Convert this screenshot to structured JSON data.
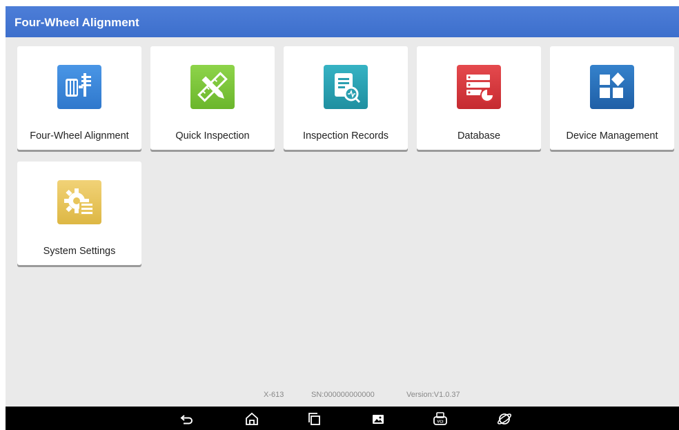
{
  "header": {
    "title": "Four-Wheel Alignment",
    "color": "#4678d4"
  },
  "tiles": [
    {
      "label": "Four-Wheel Alignment",
      "icon": "wheel-alignment-icon",
      "color": "#3a86d8"
    },
    {
      "label": "Quick Inspection",
      "icon": "ruler-pencil-icon",
      "color": "#7cc53c"
    },
    {
      "label": "Inspection Records",
      "icon": "document-search-icon",
      "color": "#2a9fb0"
    },
    {
      "label": "Database",
      "icon": "database-chart-icon",
      "color": "#d8353a"
    },
    {
      "label": "Device Management",
      "icon": "grid-diamond-icon",
      "color": "#2a6fb8"
    },
    {
      "label": "System Settings",
      "icon": "gear-list-icon",
      "color": "#e8c55a"
    }
  ],
  "footer": {
    "model": "X-613",
    "serial": "SN:000000000000",
    "version": "Version:V1.0.37"
  },
  "navbar": {
    "buttons": [
      "back-icon",
      "home-icon",
      "recent-apps-icon",
      "screenshot-icon",
      "vci-icon",
      "browser-icon"
    ]
  }
}
